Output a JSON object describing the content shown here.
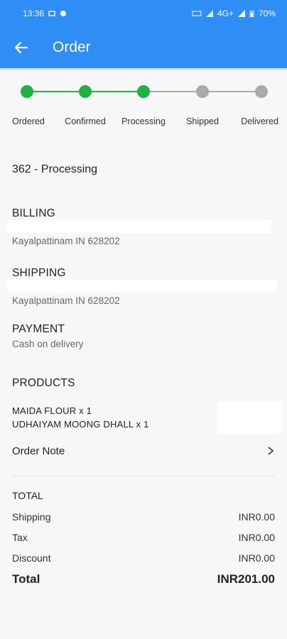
{
  "status_bar": {
    "time": "13:36",
    "network": "4G+",
    "battery": "70%"
  },
  "app_bar": {
    "title": "Order",
    "back_icon": "arrow-left-icon"
  },
  "stepper": {
    "steps": [
      {
        "label": "Ordered",
        "done": true
      },
      {
        "label": "Confirmed",
        "done": true
      },
      {
        "label": "Processing",
        "done": true
      },
      {
        "label": "Shipped",
        "done": false
      },
      {
        "label": "Delivered",
        "done": false
      }
    ],
    "active_color": "#1fb141",
    "inactive_color": "#a9a9a9"
  },
  "order": {
    "id_status": "362 - Processing"
  },
  "billing": {
    "title": "BILLING",
    "address": "Kayalpattinam IN 628202"
  },
  "shipping": {
    "title": "SHIPPING",
    "address": "Kayalpattinam IN 628202"
  },
  "payment": {
    "title": "PAYMENT",
    "method": "Cash on delivery"
  },
  "products": {
    "title": "PRODUCTS",
    "items": [
      "MAIDA FLOUR x 1",
      "UDHAIYAM MOONG DHALL x 1"
    ]
  },
  "order_note": {
    "label": "Order Note",
    "icon": "chevron-right-icon"
  },
  "totals": {
    "title": "TOTAL",
    "shipping_label": "Shipping",
    "shipping_value": "INR0.00",
    "tax_label": "Tax",
    "tax_value": "INR0.00",
    "discount_label": "Discount",
    "discount_value": "INR0.00",
    "total_label": "Total",
    "total_value": "INR201.00"
  },
  "colors": {
    "primary": "#2f8ef5"
  }
}
